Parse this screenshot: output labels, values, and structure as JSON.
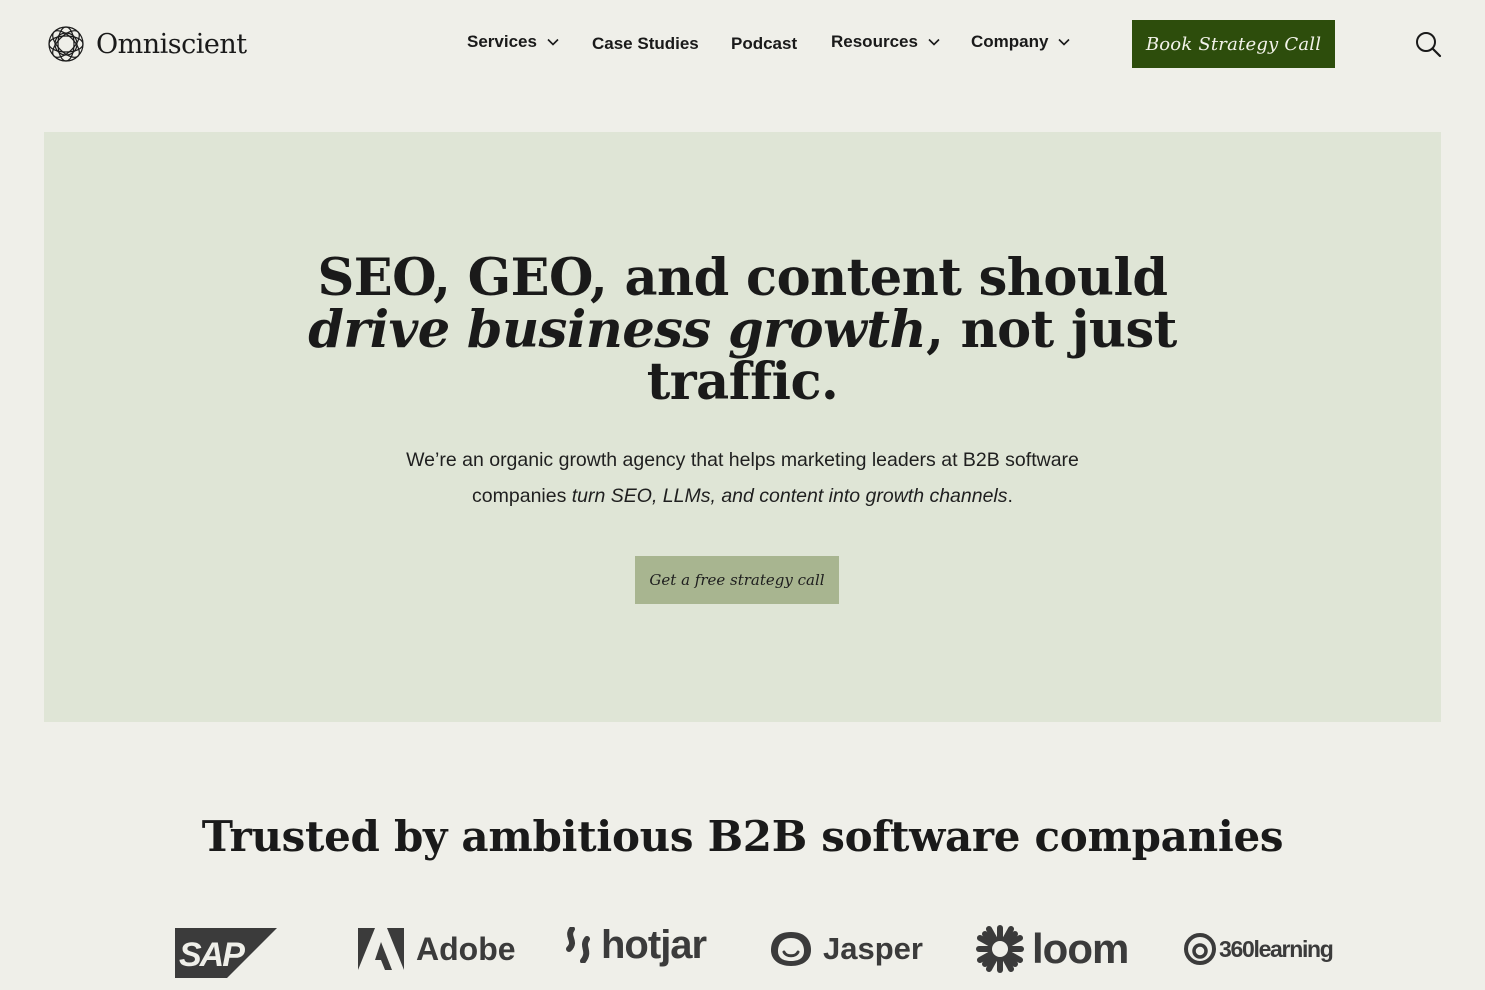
{
  "brand": {
    "name": "Omniscient",
    "logo_icon": "knot-logo-icon"
  },
  "nav": {
    "items": [
      {
        "label": "Services",
        "has_dropdown": true
      },
      {
        "label": "Case Studies",
        "has_dropdown": false
      },
      {
        "label": "Podcast",
        "has_dropdown": false
      },
      {
        "label": "Resources",
        "has_dropdown": true
      },
      {
        "label": "Company",
        "has_dropdown": true
      }
    ],
    "cta_label": "Book Strategy Call",
    "search_icon": "search-icon"
  },
  "hero": {
    "title_line1": "SEO, GEO, and content should",
    "title_line2_em": "drive business growth",
    "title_line2_rest": ", not just",
    "title_line3": "traffic.",
    "sub_line1": "We’re an organic growth agency that helps marketing leaders at B2B software",
    "sub_line2_lead": "companies ",
    "sub_line2_em": "turn SEO, LLMs, and content into growth channels",
    "sub_line2_end": ".",
    "cta_label": "Get a free strategy call"
  },
  "trust": {
    "title": "Trusted by ambitious B2B software companies",
    "logos": [
      "SAP",
      "Adobe",
      "hotjar",
      "Jasper",
      "loom",
      "360learning"
    ]
  },
  "colors": {
    "page_bg": "#efefe9",
    "hero_bg": "#dfe5d6",
    "primary_cta": "#2d4d0c",
    "secondary_cta": "#a8b590",
    "logo_gray": "#3b3b3b"
  }
}
